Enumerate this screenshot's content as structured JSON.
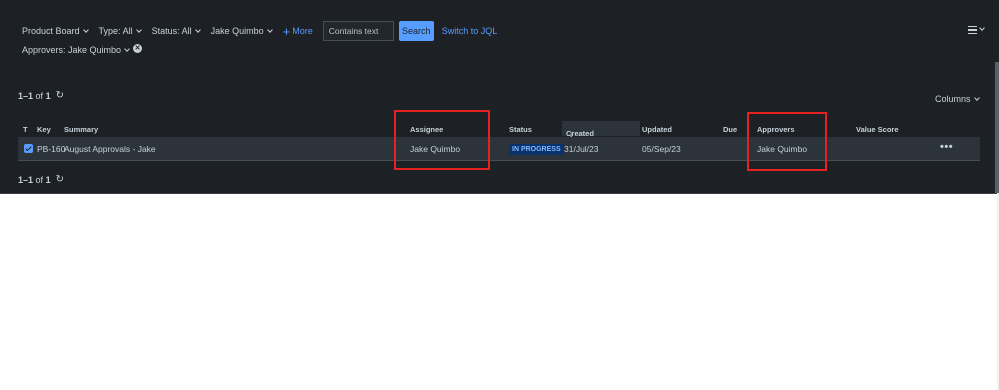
{
  "filters": {
    "project": "Product Board",
    "type": "Type: All",
    "status": "Status: All",
    "assignee": "Jake Quimbo",
    "more": "More",
    "search_text": "Contains text",
    "search_button": "Search",
    "jql_link": "Switch to JQL",
    "approvers": "Approvers: Jake Quimbo"
  },
  "pager": {
    "label": "1–1",
    "of": "of",
    "total": "1"
  },
  "columns_button": "Columns",
  "table": {
    "headers": {
      "type": "T",
      "key": "Key",
      "summary": "Summary",
      "assignee": "Assignee",
      "status": "Status",
      "created": "Created",
      "updated": "Updated",
      "due": "Due",
      "approvers": "Approvers",
      "value_score": "Value Score"
    },
    "rows": [
      {
        "key": "PB-160",
        "summary": "August Approvals - Jake",
        "assignee": "Jake Quimbo",
        "status": "IN PROGRESS",
        "created": "31/Jul/23",
        "updated": "05/Sep/23",
        "due": "",
        "approvers": "Jake Quimbo",
        "value_score": ""
      }
    ]
  },
  "colors": {
    "background": "#1d2125",
    "accent": "#579dff",
    "row": "#2c333a",
    "highlight": "#e52222",
    "status_badge": "#09326c"
  },
  "icons": [
    "chevron-down-icon",
    "plus-icon",
    "clear-icon",
    "menu-icon",
    "refresh-icon",
    "sort-down-icon",
    "checkbox-icon",
    "more-actions-icon"
  ]
}
